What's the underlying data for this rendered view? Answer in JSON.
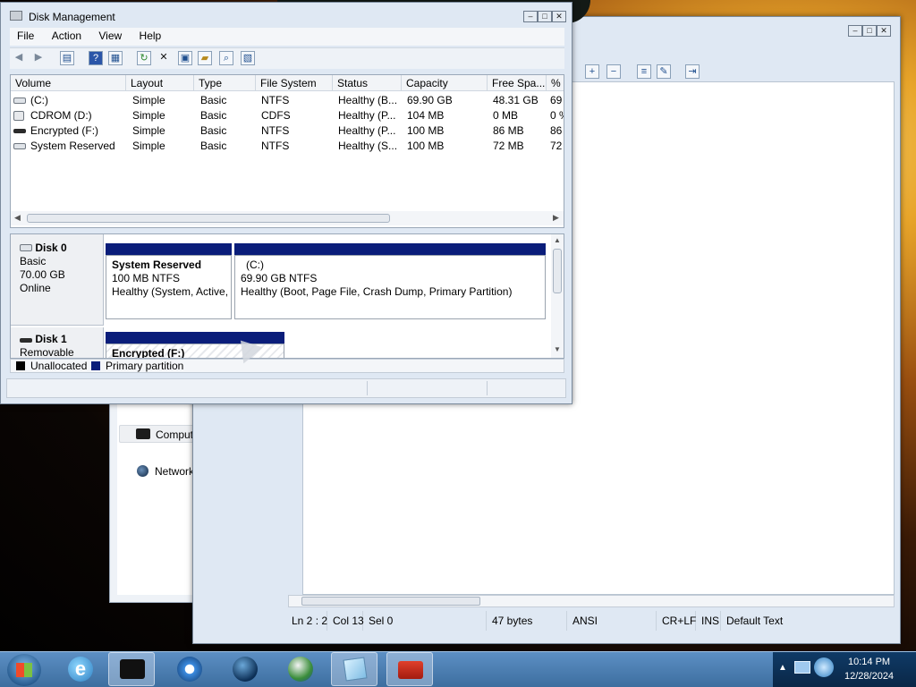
{
  "disk_mgmt": {
    "title": "Disk Management",
    "menu": [
      "File",
      "Action",
      "View",
      "Help"
    ],
    "toolbar_icons": [
      "back-arrow-icon",
      "forward-arrow-icon",
      "console-tree-icon",
      "help-icon",
      "properties-icon",
      "refresh-icon",
      "delete-icon",
      "properties-sheet-icon",
      "open-folder-icon",
      "search-icon",
      "disk-settings-icon"
    ],
    "columns": [
      "Volume",
      "Layout",
      "Type",
      "File System",
      "Status",
      "Capacity",
      "Free Spa...",
      "%"
    ],
    "rows": [
      {
        "volume": "(C:)",
        "layout": "Simple",
        "type": "Basic",
        "fs": "NTFS",
        "status": "Healthy (B...",
        "capacity": "69.90 GB",
        "free": "48.31 GB",
        "pct": "69"
      },
      {
        "volume": "CDROM (D:)",
        "layout": "Simple",
        "type": "Basic",
        "fs": "CDFS",
        "status": "Healthy (P...",
        "capacity": "104 MB",
        "free": "0 MB",
        "pct": "0 %"
      },
      {
        "volume": "Encrypted (F:)",
        "layout": "Simple",
        "type": "Basic",
        "fs": "NTFS",
        "status": "Healthy (P...",
        "capacity": "100 MB",
        "free": "86 MB",
        "pct": "86"
      },
      {
        "volume": "System Reserved",
        "layout": "Simple",
        "type": "Basic",
        "fs": "NTFS",
        "status": "Healthy (S...",
        "capacity": "100 MB",
        "free": "72 MB",
        "pct": "72"
      }
    ],
    "disks": [
      {
        "name": "Disk 0",
        "type": "Basic",
        "size": "70.00 GB",
        "state": "Online",
        "partitions": [
          {
            "label": "System Reserved",
            "size": "100 MB NTFS",
            "status": "Healthy (System, Active,"
          },
          {
            "label": "(C:)",
            "size": "69.90 GB NTFS",
            "status": "Healthy (Boot, Page File, Crash Dump, Primary Partition)"
          }
        ]
      },
      {
        "name": "Disk 1",
        "type": "Removable",
        "partitions": [
          {
            "label": "Encrypted  (F:)"
          }
        ]
      }
    ],
    "legend": {
      "unallocated": "Unallocated",
      "primary": "Primary partition"
    }
  },
  "notepad": {
    "status": {
      "position": "Ln 2 : 2",
      "col": "Col 13",
      "sel": "Sel 0",
      "bytes": "47 bytes",
      "encoding": "ANSI",
      "line_ending": "CR+LF",
      "mode": "INS",
      "style": "Default Text"
    }
  },
  "explorer_nav": {
    "computer": "Computer",
    "network": "Network"
  },
  "taskbar": {
    "time": "10:14 PM",
    "date": "12/28/2024",
    "items": [
      "internet-explorer-icon",
      "disk-management-icon",
      "media-player-icon",
      "globe-icon",
      "network-browser-icon",
      "notepad-icon",
      "toolbox-icon"
    ]
  },
  "colors": {
    "partition_primary": "#0a1d7a",
    "window_frame": "#dfe8f3"
  }
}
